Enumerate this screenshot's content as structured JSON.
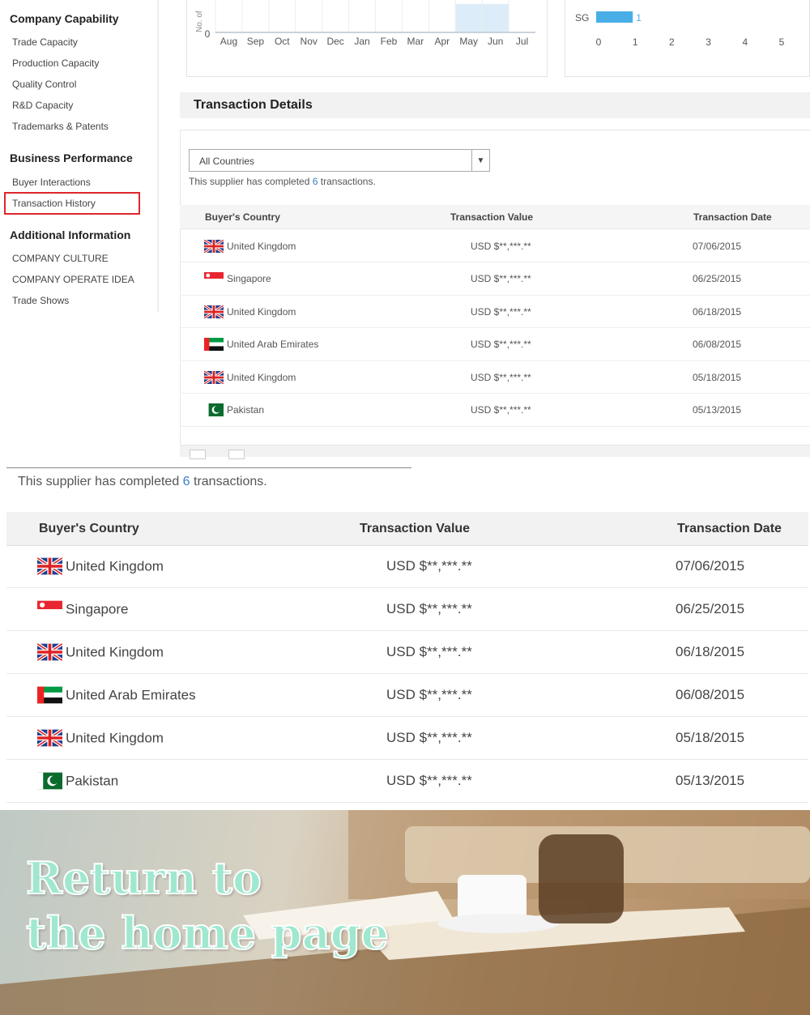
{
  "sidebar": {
    "company_capability": "Company Capability",
    "cc_items": [
      "Trade Capacity",
      "Production Capacity",
      "Quality Control",
      "R&D Capacity",
      "Trademarks & Patents"
    ],
    "business_performance": "Business Performance",
    "bp_items": [
      "Buyer Interactions",
      "Transaction History"
    ],
    "additional_information": "Additional Information",
    "ai_items": [
      "COMPANY CULTURE",
      "COMPANY OPERATE IDEA",
      "Trade Shows"
    ]
  },
  "chart_data": [
    {
      "type": "bar",
      "ylabel": "No. of",
      "categories": [
        "Aug",
        "Sep",
        "Oct",
        "Nov",
        "Dec",
        "Jan",
        "Feb",
        "Mar",
        "Apr",
        "May",
        "Jun",
        "Jul"
      ],
      "y_tick": "0",
      "highlight": [
        "May",
        "Jun"
      ]
    },
    {
      "type": "bar",
      "orientation": "horizontal",
      "categories": [
        "SG"
      ],
      "values": [
        1
      ],
      "value_label": "1",
      "x_ticks": [
        "0",
        "1",
        "2",
        "3",
        "4",
        "5"
      ],
      "xlim": [
        0,
        5
      ]
    }
  ],
  "details": {
    "title": "Transaction Details",
    "filter": "All Countries",
    "summary_pre": "This supplier has completed ",
    "count": "6",
    "summary_post": " transactions.",
    "headers": [
      "Buyer's Country",
      "Transaction Value",
      "Transaction Date"
    ],
    "rows": [
      {
        "country": "United Kingdom",
        "flag": "uk",
        "value": "USD $**,***.**",
        "date": "07/06/2015"
      },
      {
        "country": "Singapore",
        "flag": "sg",
        "value": "USD $**,***.**",
        "date": "06/25/2015"
      },
      {
        "country": "United Kingdom",
        "flag": "uk",
        "value": "USD $**,***.**",
        "date": "06/18/2015"
      },
      {
        "country": "United Arab Emirates",
        "flag": "ae",
        "value": "USD $**,***.**",
        "date": "06/08/2015"
      },
      {
        "country": "United Kingdom",
        "flag": "uk",
        "value": "USD $**,***.**",
        "date": "05/18/2015"
      },
      {
        "country": "Pakistan",
        "flag": "pk",
        "value": "USD $**,***.**",
        "date": "05/13/2015"
      }
    ]
  },
  "banner": {
    "line1": "Return to",
    "line2": "the home page"
  }
}
